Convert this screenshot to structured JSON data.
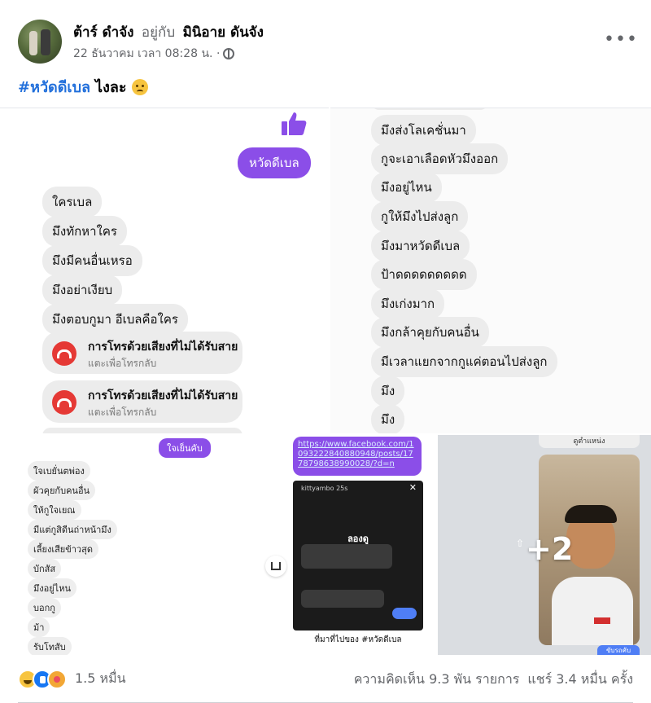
{
  "post": {
    "author": "ต้าร์ ดำจัง",
    "with_label": "อยู่กับ",
    "tagged": "มินิอาย ดันจัง",
    "timestamp": "22 ธันวาคม เวลา 08:28 น. ·",
    "privacy_icon": "globe-icon",
    "more_icon": "•••",
    "hashtag": "#หวัดดีเบล",
    "caption_rest": "ไงละ",
    "caption_emoji": "tearful-face-emoji"
  },
  "tile1": {
    "purple_bubble": "หวัดดีเบล",
    "messages": [
      "ใครเบล",
      "มึงทักหาใคร",
      "มึงมีคนอื่นเหรอ",
      "มึงอย่าเงียบ",
      "มึงตอบกูมา อีเบลคือใคร"
    ],
    "calls": [
      {
        "title": "การโทรด้วยเสียงที่ไม่ได้รับสาย",
        "sub": "แตะเพื่อโทรกลับ"
      },
      {
        "title": "การโทรด้วยเสียงที่ไม่ได้รับสาย",
        "sub": "แตะเพื่อโทรกลับ"
      }
    ]
  },
  "tile2": {
    "messages": [
      "มึงส่งโลเคชั่นมา",
      "กูจะเอาเลือดหัวมึงออก",
      "มึงอยู่ไหน",
      "กูให้มึงไปส่งลูก",
      "มึงมาหวัดดีเบล",
      "ป้าดดดดดดดดด",
      "มึงเก่งมาก",
      "มึงกล้าคุยกับคนอื่น",
      "มีเวลาแยกจากกูแค่ตอนไปส่งลูก",
      "มึง",
      "มึง"
    ]
  },
  "tile3": {
    "purple_bubble": "ใจเย็นคับ",
    "messages": [
      "ใจเบยั่นตพ่อง",
      "ผัวคุยกับคนอื่น",
      "ให้กูใจเยณ",
      "มีแต่กูสิดีนถ่าหน้ามึง",
      "เลี้ยงเสียข้าวสุด",
      "บักสัส",
      "มึงอยู่ไหน",
      "บอกกู",
      "ม้า",
      "รับโทสับ"
    ]
  },
  "tile4": {
    "link": "https://www.facebook.com/1093222840880948/posts/1778798638990028/?d=n",
    "story_user": "kittyambo 25s",
    "story_title": "ลองดู",
    "caption": "ที่มาที่ไปของ #หวัดดีเบล"
  },
  "tile5": {
    "top_label": "ดูตำแหน่ง",
    "more_count": "+2",
    "chip_label": "ขับรถคับ"
  },
  "footer": {
    "reaction_count": "1.5 หมื่น",
    "comments": "ความคิดเห็น 9.3 พัน รายการ",
    "shares": "แชร์ 3.4 หมื่น ครั้ง"
  },
  "colors": {
    "hashtag": "#216fdb",
    "messenger_purple": "#8b4ee8",
    "missed_call": "#e53935",
    "meta_gray": "#65676b"
  }
}
